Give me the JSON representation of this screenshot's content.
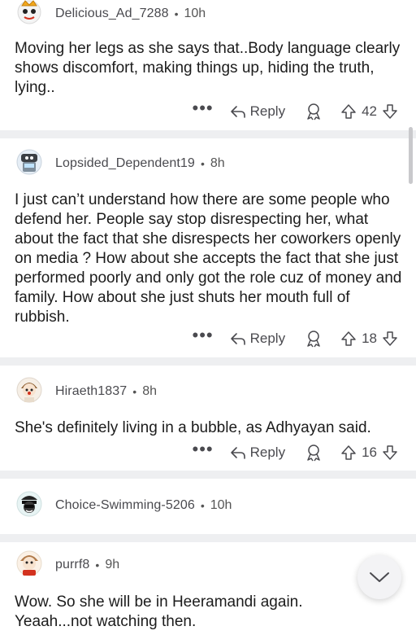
{
  "comments": [
    {
      "username": "Delicious_Ad_7288",
      "time": "10h",
      "text": "Moving her legs as she says that..Body language clearly shows discomfort, making things up, hiding the truth, lying..",
      "reply_label": "Reply",
      "votes": "42"
    },
    {
      "username": "Lopsided_Dependent19",
      "time": "8h",
      "text": "I just can’t understand how there are some people who defend her. People say stop disrespecting her, what about the fact that she disrespects her coworkers openly on media ? How about she accepts the fact that she just performed poorly and only got the role cuz of money and family. How about she just shuts her mouth full of rubbish.",
      "reply_label": "Reply",
      "votes": "18"
    },
    {
      "username": "Hiraeth1837",
      "time": "8h",
      "text": "She's definitely living in a bubble, as Adhyayan said.",
      "reply_label": "Reply",
      "votes": "16"
    },
    {
      "username": "Choice-Swimming-5206",
      "time": "10h"
    },
    {
      "username": "purrf8",
      "time": "9h",
      "text": "Wow. So she will be in Heeramandi again. Yeaah...not watching then."
    }
  ],
  "separator_dot": "•",
  "more_label": "•••",
  "colors": {
    "text": "#1c1c1c",
    "meta": "#4a4a4f",
    "separator": "#eeeff1"
  }
}
